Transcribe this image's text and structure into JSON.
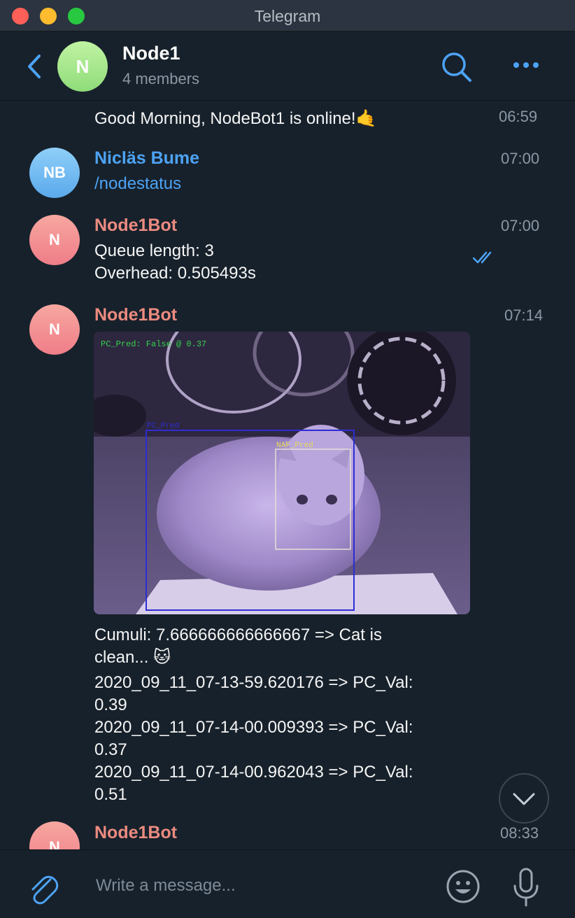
{
  "window": {
    "title": "Telegram"
  },
  "header": {
    "avatar_initial": "N",
    "chat_name": "Node1",
    "members": "4 members",
    "icons": {
      "back": "chevron-left-icon",
      "search": "search-icon",
      "more": "more-dots-icon"
    }
  },
  "messages": [
    {
      "type": "continuation",
      "text": "Good Morning, NodeBot1 is online!🤙",
      "time": "06:59"
    },
    {
      "type": "message",
      "avatar": "NB",
      "avatar_color": "#5aa9ec",
      "sender": "Nicläs Bume",
      "sender_color": "#4da3f5",
      "text": "/nodestatus",
      "time": "07:00",
      "status": "read-double-check"
    },
    {
      "type": "message",
      "avatar": "N",
      "avatar_color": "#ef7d88",
      "sender": "Node1Bot",
      "sender_color": "#ec8b80",
      "lines": [
        "Queue length: 3",
        "Overhead: 0.505493s"
      ],
      "time": "07:00"
    },
    {
      "type": "photo-message",
      "avatar": "N",
      "sender": "Node1Bot",
      "time": "07:14",
      "photo": {
        "overlay_top": "PC_Pred: False @ 0.37",
        "box1_label": "PC_Pred",
        "box2_label": "NAF_Pred"
      },
      "lines": [
        "Cumuli: 7.666666666666667 => Cat is",
        "clean... 🐱",
        "2020_09_11_07-13-59.620176 => PC_Val:",
        "0.39",
        "2020_09_11_07-14-00.009393 => PC_Val:",
        "0.37",
        "2020_09_11_07-14-00.962043 => PC_Val:",
        "0.51"
      ]
    },
    {
      "type": "message",
      "avatar": "N",
      "sender": "Node1Bot",
      "time": "08:33"
    }
  ],
  "composer": {
    "placeholder": "Write a message...",
    "icons": {
      "attach": "paperclip-icon",
      "emoji": "smiley-icon",
      "voice": "microphone-icon"
    }
  },
  "scroll_button": {
    "icon": "chevron-down-icon"
  },
  "colors": {
    "background": "#17212b",
    "accent": "#4da3f5",
    "bot_name": "#ec8b80"
  }
}
